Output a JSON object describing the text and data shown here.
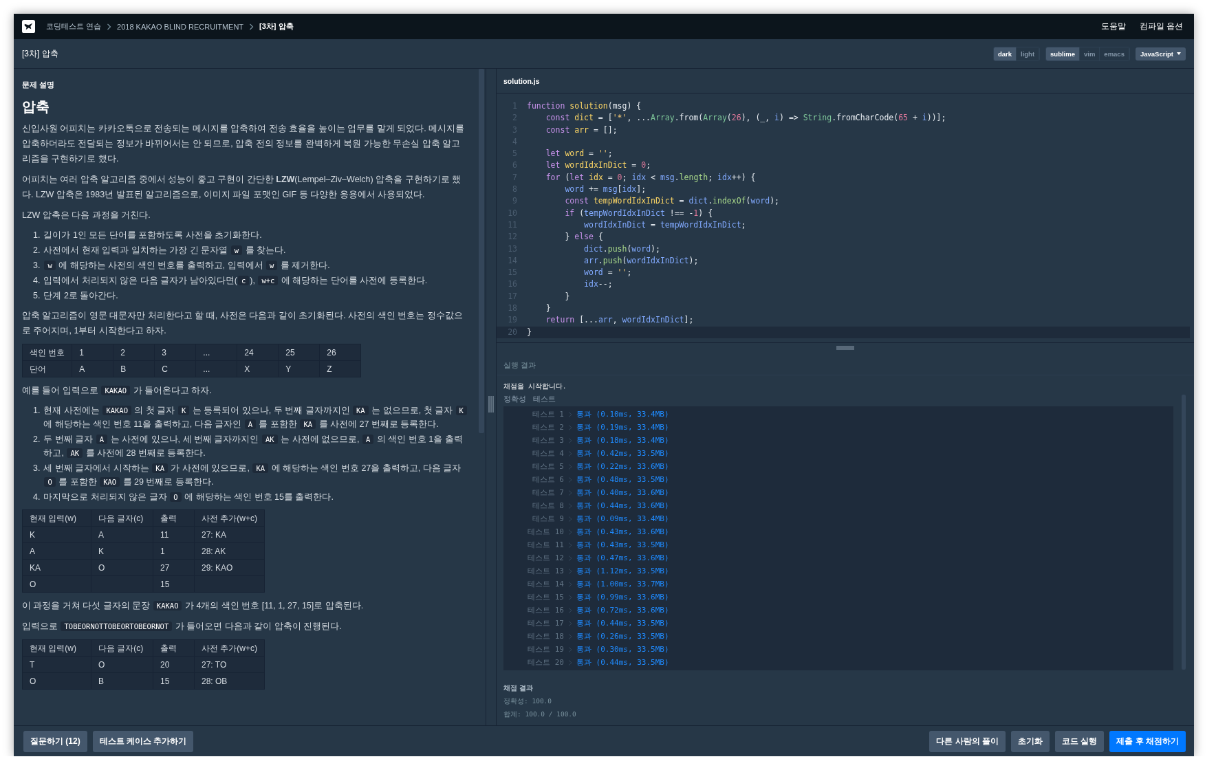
{
  "nav": {
    "breadcrumbs": [
      {
        "label": "코딩테스트 연습",
        "current": false
      },
      {
        "label": "2018 KAKAO BLIND RECRUITMENT",
        "current": false
      },
      {
        "label": "[3차] 압축",
        "current": true
      }
    ],
    "links": [
      "도움말",
      "컴파일 옵션"
    ]
  },
  "title_bar": {
    "title": "[3차] 압축",
    "theme_options": [
      {
        "label": "dark",
        "selected": true
      },
      {
        "label": "light",
        "selected": false
      }
    ],
    "keymap_options": [
      {
        "label": "sublime",
        "selected": true
      },
      {
        "label": "vim",
        "selected": false
      },
      {
        "label": "emacs",
        "selected": false
      }
    ],
    "language": "JavaScript"
  },
  "problem": {
    "section_label": "문제 설명",
    "title": "압축",
    "blocks": [
      {
        "kind": "paragraph",
        "segments": [
          {
            "kind": "text",
            "text": "신입사원 어피치는 카카오톡으로 전송되는 메시지를 압축하여 전송 효율을 높이는 업무를 맡게 되었다. 메시지를 압축하더라도 전달되는 정보가 바뀌어서는 안 되므로, 압축 전의 정보를 완벽하게 복원 가능한 무손실 압축 알고리즘을 구현하기로 했다."
          }
        ]
      },
      {
        "kind": "paragraph",
        "segments": [
          {
            "kind": "text",
            "text": "어피치는 여러 압축 알고리즘 중에서 성능이 좋고 구현이 간단한 **LZW**(Lempel–Ziv–Welch) 압축을 구현하기로 했다. LZW 압축은 1983년 발표된 알고리즘으로, 이미지 파일 포맷인 GIF 등 다양한 응용에서 사용되었다."
          }
        ]
      },
      {
        "kind": "paragraph",
        "segments": [
          {
            "kind": "text",
            "text": "LZW 압축은 다음 과정을 거친다."
          }
        ]
      },
      {
        "kind": "list",
        "items": [
          {
            "number": "1.",
            "segments": [
              {
                "kind": "text",
                "text": "길이가 1인 모든 단어를 포함하도록 사전을 초기화한다."
              }
            ]
          },
          {
            "number": "2.",
            "segments": [
              {
                "kind": "text",
                "text": "사전에서 현재 입력과 일치하는 가장 긴 문자열 "
              },
              {
                "kind": "code",
                "text": "w"
              },
              {
                "kind": "text",
                "text": " 를 찾는다."
              }
            ]
          },
          {
            "number": "3.",
            "segments": [
              {
                "kind": "code",
                "text": "w"
              },
              {
                "kind": "text",
                "text": " 에 해당하는 사전의 색인 번호를 출력하고, 입력에서 "
              },
              {
                "kind": "code",
                "text": "w"
              },
              {
                "kind": "text",
                "text": " 를 제거한다."
              }
            ]
          },
          {
            "number": "4.",
            "segments": [
              {
                "kind": "text",
                "text": "입력에서 처리되지 않은 다음 글자가 남아있다면("
              },
              {
                "kind": "code",
                "text": "c"
              },
              {
                "kind": "text",
                "text": "), "
              },
              {
                "kind": "code",
                "text": "w+c"
              },
              {
                "kind": "text",
                "text": " 에 해당하는 단어를 사전에 등록한다."
              }
            ]
          },
          {
            "number": "5.",
            "segments": [
              {
                "kind": "text",
                "text": "단계 2로 돌아간다."
              }
            ]
          }
        ]
      },
      {
        "kind": "paragraph",
        "segments": [
          {
            "kind": "text",
            "text": "압축 알고리즘이 영문 대문자만 처리한다고 할 때, 사전은 다음과 같이 초기화된다. 사전의 색인 번호는 정수값으로 주어지며, 1부터 시작한다고 하자."
          }
        ]
      },
      {
        "kind": "table",
        "rows": [
          [
            "색인 번호",
            "1",
            "2",
            "3",
            "...",
            "24",
            "25",
            "26"
          ],
          [
            "단어",
            "A",
            "B",
            "C",
            "...",
            "X",
            "Y",
            "Z"
          ]
        ]
      },
      {
        "kind": "paragraph",
        "segments": [
          {
            "kind": "text",
            "text": "예를 들어 입력으로 "
          },
          {
            "kind": "code",
            "text": "KAKAO"
          },
          {
            "kind": "text",
            "text": " 가 들어온다고 하자."
          }
        ]
      },
      {
        "kind": "list",
        "items": [
          {
            "number": "1.",
            "segments": [
              {
                "kind": "text",
                "text": "현재 사전에는 "
              },
              {
                "kind": "code",
                "text": "KAKAO"
              },
              {
                "kind": "text",
                "text": " 의 첫 글자 "
              },
              {
                "kind": "code",
                "text": "K"
              },
              {
                "kind": "text",
                "text": " 는 등록되어 있으나, 두 번째 글자까지인 "
              },
              {
                "kind": "code",
                "text": "KA"
              },
              {
                "kind": "text",
                "text": " 는 없으므로, 첫 글자 "
              },
              {
                "kind": "code",
                "text": "K"
              },
              {
                "kind": "text",
                "text": " 에 해당하는 색인 번호 11을 출력하고, 다음 글자인 "
              },
              {
                "kind": "code",
                "text": "A"
              },
              {
                "kind": "text",
                "text": " 를 포함한 "
              },
              {
                "kind": "code",
                "text": "KA"
              },
              {
                "kind": "text",
                "text": " 를 사전에 27 번째로 등록한다."
              }
            ]
          },
          {
            "number": "2.",
            "segments": [
              {
                "kind": "text",
                "text": "두 번째 글자 "
              },
              {
                "kind": "code",
                "text": "A"
              },
              {
                "kind": "text",
                "text": " 는 사전에 있으나, 세 번째 글자까지인 "
              },
              {
                "kind": "code",
                "text": "AK"
              },
              {
                "kind": "text",
                "text": " 는 사전에 없으므로, "
              },
              {
                "kind": "code",
                "text": "A"
              },
              {
                "kind": "text",
                "text": " 의 색인 번호 1을 출력하고, "
              },
              {
                "kind": "code",
                "text": "AK"
              },
              {
                "kind": "text",
                "text": " 를 사전에 28 번째로 등록한다."
              }
            ]
          },
          {
            "number": "3.",
            "segments": [
              {
                "kind": "text",
                "text": "세 번째 글자에서 시작하는 "
              },
              {
                "kind": "code",
                "text": "KA"
              },
              {
                "kind": "text",
                "text": " 가 사전에 있으므로, "
              },
              {
                "kind": "code",
                "text": "KA"
              },
              {
                "kind": "text",
                "text": " 에 해당하는 색인 번호 27을 출력하고, 다음 글자 "
              },
              {
                "kind": "code",
                "text": "O"
              },
              {
                "kind": "text",
                "text": " 를 포함한 "
              },
              {
                "kind": "code",
                "text": "KAO"
              },
              {
                "kind": "text",
                "text": " 를 29 번째로 등록한다."
              }
            ]
          },
          {
            "number": "4.",
            "segments": [
              {
                "kind": "text",
                "text": "마지막으로 처리되지 않은 글자 "
              },
              {
                "kind": "code",
                "text": "O"
              },
              {
                "kind": "text",
                "text": " 에 해당하는 색인 번호 15를 출력한다."
              }
            ]
          }
        ]
      },
      {
        "kind": "table",
        "columns": [
          "현재 입력(w)",
          "다음 글자(c)",
          "출력",
          "사전 추가(w+c)"
        ],
        "rows": [
          [
            "K",
            "A",
            "11",
            "27: KA"
          ],
          [
            "A",
            "K",
            "1",
            "28: AK"
          ],
          [
            "KA",
            "O",
            "27",
            "29: KAO"
          ],
          [
            "O",
            "",
            "15",
            ""
          ]
        ]
      },
      {
        "kind": "paragraph",
        "segments": [
          {
            "kind": "text",
            "text": "이 과정을 거쳐 다섯 글자의 문장 "
          },
          {
            "kind": "code",
            "text": "KAKAO"
          },
          {
            "kind": "text",
            "text": " 가 4개의 색인 번호 [11, 1, 27, 15]로 압축된다."
          }
        ]
      },
      {
        "kind": "paragraph",
        "segments": [
          {
            "kind": "text",
            "text": "입력으로 "
          },
          {
            "kind": "code",
            "text": "TOBEORNOTTOBEORTOBEORNOT"
          },
          {
            "kind": "text",
            "text": " 가 들어오면 다음과 같이 압축이 진행된다."
          }
        ]
      },
      {
        "kind": "table",
        "columns": [
          "현재 입력(w)",
          "다음 글자(c)",
          "출력",
          "사전 추가(w+c)"
        ],
        "rows": [
          [
            "T",
            "O",
            "20",
            "27: TO"
          ],
          [
            "O",
            "B",
            "15",
            "28: OB"
          ]
        ]
      }
    ]
  },
  "editor": {
    "filename": "solution.js",
    "lines": [
      {
        "number": "1",
        "active": false,
        "tokens": [
          {
            "kind": "kw",
            "text": "function"
          },
          {
            "kind": "def",
            "text": " solution"
          },
          {
            "kind": "p",
            "text": "(msg) {"
          }
        ]
      },
      {
        "number": "2",
        "active": false,
        "tokens": [
          {
            "kind": "kw",
            "text": "    const"
          },
          {
            "kind": "def",
            "text": " dict"
          },
          {
            "kind": "p",
            "text": " = ["
          },
          {
            "kind": "str",
            "text": "'*'"
          },
          {
            "kind": "p",
            "text": ", ..."
          },
          {
            "kind": "type",
            "text": "Array"
          },
          {
            "kind": "p",
            "text": ".from("
          },
          {
            "kind": "type",
            "text": "Array"
          },
          {
            "kind": "p",
            "text": "("
          },
          {
            "kind": "num",
            "text": "26"
          },
          {
            "kind": "p",
            "text": "), (_, "
          },
          {
            "kind": "var",
            "text": "i"
          },
          {
            "kind": "p",
            "text": ") => "
          },
          {
            "kind": "type",
            "text": "String"
          },
          {
            "kind": "p",
            "text": ".fromCharCode("
          },
          {
            "kind": "num",
            "text": "65"
          },
          {
            "kind": "p",
            "text": " + "
          },
          {
            "kind": "var",
            "text": "i"
          },
          {
            "kind": "p",
            "text": "))];"
          }
        ]
      },
      {
        "number": "3",
        "active": false,
        "tokens": [
          {
            "kind": "kw",
            "text": "    const"
          },
          {
            "kind": "def",
            "text": " arr"
          },
          {
            "kind": "p",
            "text": " = [];"
          }
        ]
      },
      {
        "number": "4",
        "active": false
      },
      {
        "number": "5",
        "active": false,
        "tokens": [
          {
            "kind": "kw",
            "text": "    let"
          },
          {
            "kind": "def",
            "text": " word"
          },
          {
            "kind": "p",
            "text": " = "
          },
          {
            "kind": "str",
            "text": "''"
          },
          {
            "kind": "p",
            "text": ";"
          }
        ]
      },
      {
        "number": "6",
        "active": false,
        "tokens": [
          {
            "kind": "kw",
            "text": "    let"
          },
          {
            "kind": "def",
            "text": " wordIdxInDict"
          },
          {
            "kind": "p",
            "text": " = "
          },
          {
            "kind": "num",
            "text": "0"
          },
          {
            "kind": "p",
            "text": ";"
          }
        ]
      },
      {
        "number": "7",
        "active": false,
        "tokens": [
          {
            "kind": "kw",
            "text": "    for"
          },
          {
            "kind": "p",
            "text": " ("
          },
          {
            "kind": "kw",
            "text": "let"
          },
          {
            "kind": "def",
            "text": " idx"
          },
          {
            "kind": "p",
            "text": " = "
          },
          {
            "kind": "num",
            "text": "0"
          },
          {
            "kind": "p",
            "text": "; "
          },
          {
            "kind": "var",
            "text": "idx"
          },
          {
            "kind": "p",
            "text": " < "
          },
          {
            "kind": "var",
            "text": "msg"
          },
          {
            "kind": "p",
            "text": "."
          },
          {
            "kind": "fn",
            "text": "length"
          },
          {
            "kind": "p",
            "text": "; "
          },
          {
            "kind": "var",
            "text": "idx"
          },
          {
            "kind": "p",
            "text": "++) {"
          }
        ]
      },
      {
        "number": "8",
        "active": false,
        "tokens": [
          {
            "kind": "var",
            "text": "        word"
          },
          {
            "kind": "p",
            "text": " += "
          },
          {
            "kind": "var",
            "text": "msg"
          },
          {
            "kind": "p",
            "text": "["
          },
          {
            "kind": "var",
            "text": "idx"
          },
          {
            "kind": "p",
            "text": "];"
          }
        ]
      },
      {
        "number": "9",
        "active": false,
        "tokens": [
          {
            "kind": "kw",
            "text": "        const"
          },
          {
            "kind": "def",
            "text": " tempWordIdxInDict"
          },
          {
            "kind": "p",
            "text": " = "
          },
          {
            "kind": "var",
            "text": "dict"
          },
          {
            "kind": "p",
            "text": "."
          },
          {
            "kind": "fn",
            "text": "indexOf"
          },
          {
            "kind": "p",
            "text": "("
          },
          {
            "kind": "var",
            "text": "word"
          },
          {
            "kind": "p",
            "text": ");"
          }
        ]
      },
      {
        "number": "10",
        "active": false,
        "tokens": [
          {
            "kind": "kw",
            "text": "        if"
          },
          {
            "kind": "p",
            "text": " ("
          },
          {
            "kind": "var",
            "text": "tempWordIdxInDict"
          },
          {
            "kind": "p",
            "text": " !== -"
          },
          {
            "kind": "num",
            "text": "1"
          },
          {
            "kind": "p",
            "text": ") {"
          }
        ]
      },
      {
        "number": "11",
        "active": false,
        "tokens": [
          {
            "kind": "var",
            "text": "            wordIdxInDict"
          },
          {
            "kind": "p",
            "text": " = "
          },
          {
            "kind": "var",
            "text": "tempWordIdxInDict"
          },
          {
            "kind": "p",
            "text": ";"
          }
        ]
      },
      {
        "number": "12",
        "active": false,
        "tokens": [
          {
            "kind": "p",
            "text": "        } "
          },
          {
            "kind": "kw",
            "text": "else"
          },
          {
            "kind": "p",
            "text": " {"
          }
        ]
      },
      {
        "number": "13",
        "active": false,
        "tokens": [
          {
            "kind": "var",
            "text": "            dict"
          },
          {
            "kind": "p",
            "text": "."
          },
          {
            "kind": "fn",
            "text": "push"
          },
          {
            "kind": "p",
            "text": "("
          },
          {
            "kind": "var",
            "text": "word"
          },
          {
            "kind": "p",
            "text": ");"
          }
        ]
      },
      {
        "number": "14",
        "active": false,
        "tokens": [
          {
            "kind": "var",
            "text": "            arr"
          },
          {
            "kind": "p",
            "text": "."
          },
          {
            "kind": "fn",
            "text": "push"
          },
          {
            "kind": "p",
            "text": "("
          },
          {
            "kind": "var",
            "text": "wordIdxInDict"
          },
          {
            "kind": "p",
            "text": ");"
          }
        ]
      },
      {
        "number": "15",
        "active": false,
        "tokens": [
          {
            "kind": "var",
            "text": "            word"
          },
          {
            "kind": "p",
            "text": " = "
          },
          {
            "kind": "str",
            "text": "''"
          },
          {
            "kind": "p",
            "text": ";"
          }
        ]
      },
      {
        "number": "16",
        "active": false,
        "tokens": [
          {
            "kind": "var",
            "text": "            idx"
          },
          {
            "kind": "p",
            "text": "--;"
          }
        ]
      },
      {
        "number": "17",
        "active": false,
        "tokens": [
          {
            "kind": "p",
            "text": "        }"
          }
        ]
      },
      {
        "number": "18",
        "active": false,
        "tokens": [
          {
            "kind": "p",
            "text": "    }"
          }
        ]
      },
      {
        "number": "19",
        "active": false,
        "tokens": [
          {
            "kind": "kw",
            "text": "    return"
          },
          {
            "kind": "p",
            "text": " [..."
          },
          {
            "kind": "var",
            "text": "arr"
          },
          {
            "kind": "p",
            "text": ", "
          },
          {
            "kind": "var",
            "text": "wordIdxInDict"
          },
          {
            "kind": "p",
            "text": "];"
          }
        ]
      },
      {
        "number": "20",
        "active": true,
        "tokens": [
          {
            "kind": "p",
            "text": "}"
          }
        ]
      }
    ]
  },
  "results": {
    "title": "실행 결과",
    "start_message": "채점을 시작합니다.",
    "group_tabs": [
      "정확성",
      "테스트"
    ],
    "tests": [
      {
        "label": "테스트 1",
        "result": "통과 (0.10ms, 33.4MB)"
      },
      {
        "label": "테스트 2",
        "result": "통과 (0.19ms, 33.4MB)"
      },
      {
        "label": "테스트 3",
        "result": "통과 (0.18ms, 33.4MB)"
      },
      {
        "label": "테스트 4",
        "result": "통과 (0.42ms, 33.5MB)"
      },
      {
        "label": "테스트 5",
        "result": "통과 (0.22ms, 33.6MB)"
      },
      {
        "label": "테스트 6",
        "result": "통과 (0.48ms, 33.5MB)"
      },
      {
        "label": "테스트 7",
        "result": "통과 (0.40ms, 33.6MB)"
      },
      {
        "label": "테스트 8",
        "result": "통과 (0.44ms, 33.6MB)"
      },
      {
        "label": "테스트 9",
        "result": "통과 (0.09ms, 33.4MB)"
      },
      {
        "label": "테스트 10",
        "result": "통과 (0.43ms, 33.6MB)"
      },
      {
        "label": "테스트 11",
        "result": "통과 (0.43ms, 33.5MB)"
      },
      {
        "label": "테스트 12",
        "result": "통과 (0.47ms, 33.6MB)"
      },
      {
        "label": "테스트 13",
        "result": "통과 (1.12ms, 33.5MB)"
      },
      {
        "label": "테스트 14",
        "result": "통과 (1.00ms, 33.7MB)"
      },
      {
        "label": "테스트 15",
        "result": "통과 (0.99ms, 33.6MB)"
      },
      {
        "label": "테스트 16",
        "result": "통과 (0.72ms, 33.6MB)"
      },
      {
        "label": "테스트 17",
        "result": "통과 (0.44ms, 33.5MB)"
      },
      {
        "label": "테스트 18",
        "result": "통과 (0.26ms, 33.5MB)"
      },
      {
        "label": "테스트 19",
        "result": "통과 (0.30ms, 33.5MB)"
      },
      {
        "label": "테스트 20",
        "result": "통과 (0.44ms, 33.5MB)"
      }
    ],
    "summary_title": "채점 결과",
    "summary_lines": [
      "정확성: 100.0",
      "합계: 100.0 / 100.0"
    ]
  },
  "footer": {
    "left_buttons": [
      {
        "label": "질문하기 (12)",
        "kind": "secondary"
      },
      {
        "label": "테스트 케이스 추가하기",
        "kind": "secondary"
      }
    ],
    "right_buttons": [
      {
        "label": "다른 사람의 풀이",
        "kind": "secondary"
      },
      {
        "label": "초기화",
        "kind": "secondary"
      },
      {
        "label": "코드 실행",
        "kind": "secondary"
      },
      {
        "label": "제출 후 채점하기",
        "kind": "primary"
      }
    ]
  }
}
